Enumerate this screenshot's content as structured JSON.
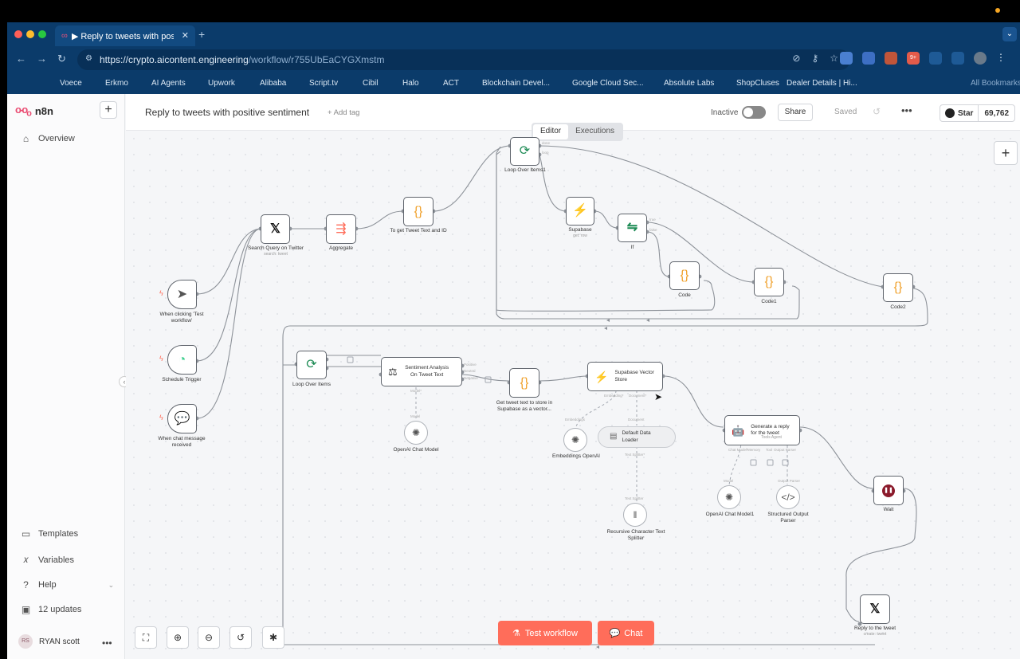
{
  "browser": {
    "tab_title": "▶ Reply to tweets with positive sentiment",
    "url_host": "https://crypto.aicontent.engineering",
    "url_path": "/workflow/r755UbEaCYGXmstm",
    "bookmarks": [
      "Voece",
      "Erkmo",
      "AI Agents",
      "Upwork",
      "Alibaba",
      "Script.tv",
      "Cibil",
      "Halo",
      "ACT",
      "Blockchain Devel...",
      "Google Cloud Sec...",
      "Absolute Labs",
      "ShopCluses",
      "Dealer Details | Hi...",
      "All Bookmarks"
    ],
    "ext_badge": "9+"
  },
  "sidebar": {
    "brand": "n8n",
    "overview": "Overview",
    "templates": "Templates",
    "variables": "Variables",
    "help": "Help",
    "updates": "12 updates",
    "user_initials": "RS",
    "user_name": "RYAN scott"
  },
  "header": {
    "workflow_name": "Reply to tweets with positive sentiment",
    "add_tag": "+ Add tag",
    "status": "Inactive",
    "share": "Share",
    "saved": "Saved",
    "star": "Star",
    "star_count": "69,762"
  },
  "canvas": {
    "editor_tab": "Editor",
    "executions_tab": "Executions",
    "nodes": {
      "loop1": "Loop Over Items1",
      "loop1_done": "done",
      "loop1_loop": "loop",
      "supabase": "Supabase",
      "supabase_sub": "get: row",
      "if": "If",
      "if_true": "true",
      "if_false": "false",
      "code": "Code",
      "code1": "Code1",
      "code2": "Code2",
      "search": "Search Query on Twitter",
      "search_sub": "search: tweet",
      "aggregate": "Aggregate",
      "get_text": "To get Tweet Text and ID",
      "manual": "When clicking 'Test workflow'",
      "schedule": "Schedule Trigger",
      "chat_trigger": "When chat message received",
      "loop": "Loop Over Items",
      "sentiment": "Sentiment Analysis On Tweet Text",
      "positive": "Positive",
      "neutral": "Neutral",
      "negative": "Negative",
      "model_port": "Model*",
      "model": "Model",
      "openai": "OpenAI Chat Model",
      "store_text": "Get tweet text to store in Supabase as a vector...",
      "vector": "Supabase Vector Store",
      "embedding_port": "Embedding*",
      "document_port": "Document*",
      "embeddings_lbl": "Embeddings",
      "document_lbl": "Document",
      "embeddings": "Embeddings OpenAI",
      "loader": "Default Data Loader",
      "textsplitter_port": "Text Splitter*",
      "textsplitter_lbl": "Text Splitter",
      "splitter": "Recursive Character Text Splitter",
      "generate": "Generate a reply for the tweet",
      "generate_sub": "Tools Agent",
      "chatmodel_port": "Chat Model*",
      "memory_port": "Memory",
      "tool_port": "Tool",
      "outparser_port": "Output Parser",
      "openai1": "OpenAI Chat Model1",
      "parser": "Structured Output Parser",
      "wait": "Wait",
      "reply": "Reply to the tweet",
      "reply_sub": "create: tweet"
    },
    "test_workflow": "Test workflow",
    "chat": "Chat"
  },
  "colors": {
    "brand": "#ea4b71",
    "cta": "#ff6d5a",
    "chrome": "#0b3b6a"
  }
}
